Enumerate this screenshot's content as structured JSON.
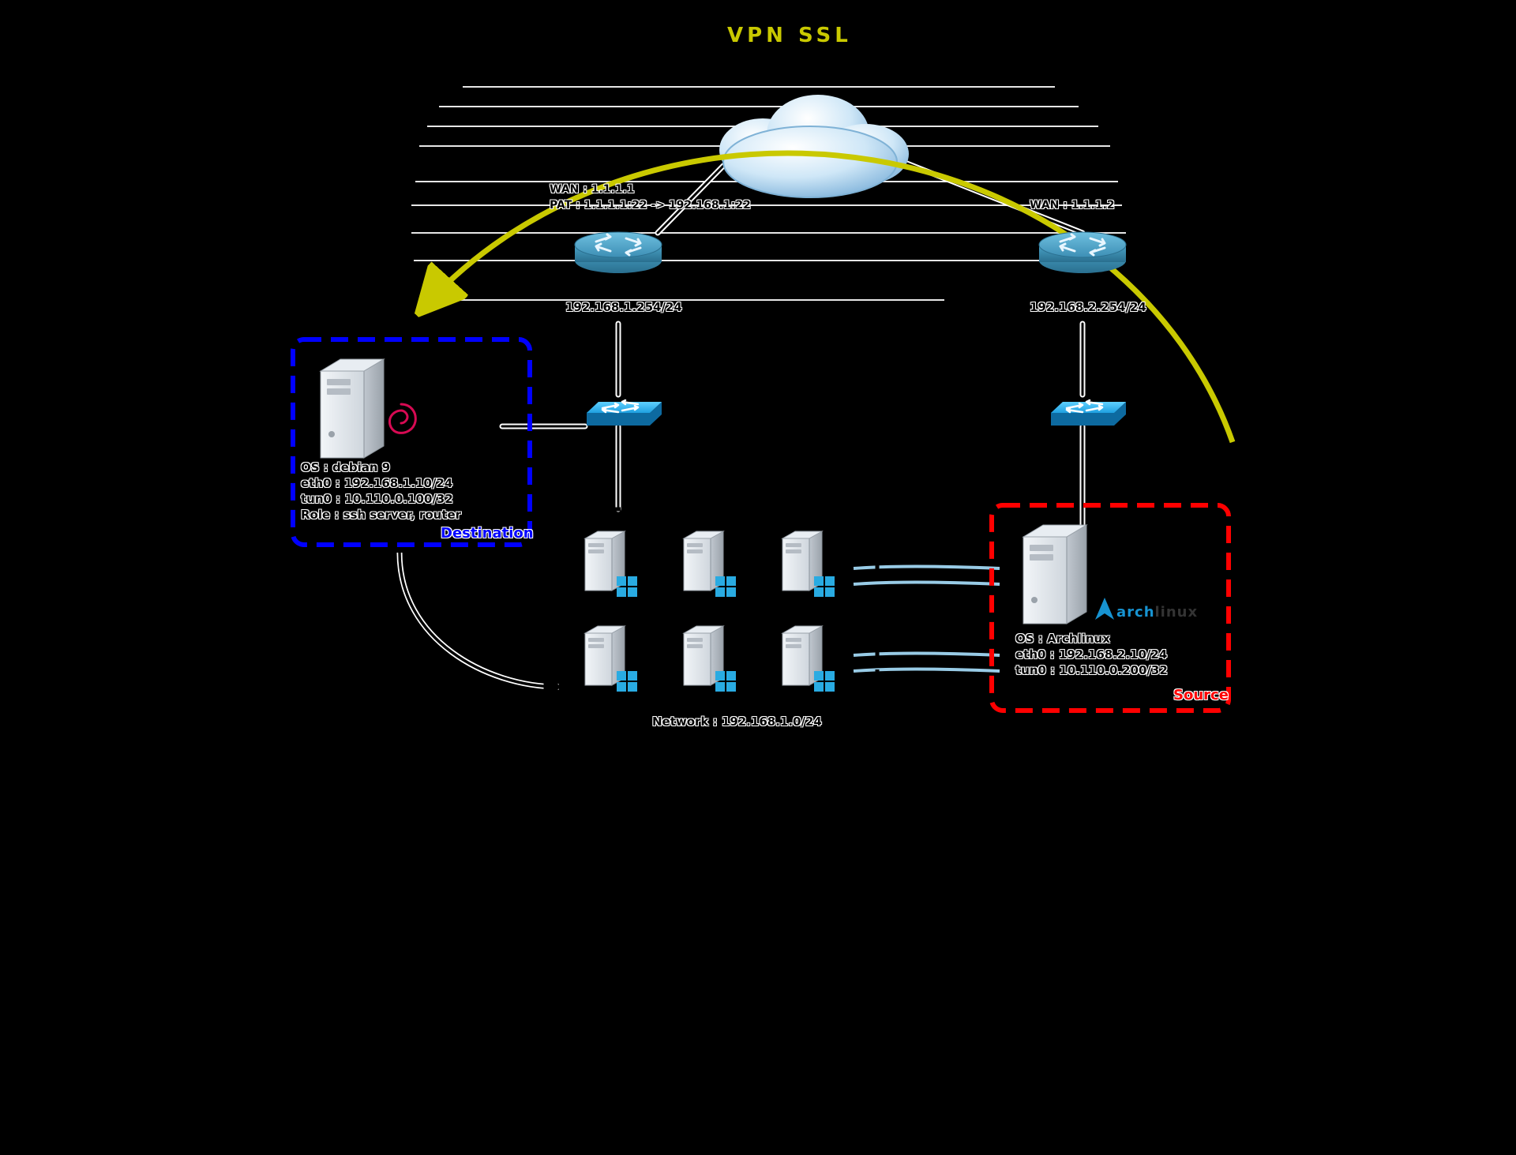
{
  "vpn_label": "VPN SSL",
  "router_left": {
    "wan": "WAN : 1.1.1.1",
    "pat": "PAT : 1.1.1.1:22 -> 192.168.1:22",
    "lan": "192.168.1.254/24"
  },
  "router_right": {
    "wan": "WAN : 1.1.1.2",
    "lan": "192.168.2.254/24"
  },
  "destination": {
    "title": "Destination",
    "os": "OS : debian 9",
    "eth0": "eth0 : 192.168.1.10/24",
    "tun0": "tun0 : 10.110.0.100/32",
    "role": "Role : ssh server, router"
  },
  "source": {
    "title": "Source",
    "logo_text": "archlinux",
    "os": "OS : Archlinux",
    "eth0": "eth0 : 192.168.2.10/24",
    "tun0": "tun0 : 10.110.0.200/32"
  },
  "network_label": "Network : 192.168.1.0/24"
}
